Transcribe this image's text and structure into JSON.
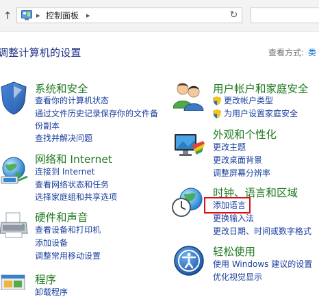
{
  "address_bar": {
    "up_arrow": "↑",
    "breadcrumb_sep": "▸",
    "breadcrumb": "控制面板",
    "dropdown": "▾",
    "refresh": "↻"
  },
  "header": {
    "title": "调整计算机的设置",
    "view_by_label": "查看方式:",
    "view_by_value": "类"
  },
  "categories": {
    "system": {
      "title": "系统和安全",
      "links": [
        "查看你的计算机状态",
        "通过文件历史记录保存你的文件备",
        "份副本",
        "查找并解决问题"
      ]
    },
    "network": {
      "title": "网络和 Internet",
      "links": [
        "连接到 Internet",
        "查看网络状态和任务",
        "选择家庭组和共享选项"
      ]
    },
    "hardware": {
      "title": "硬件和声音",
      "links": [
        "查看设备和打印机",
        "添加设备",
        "调整常用移动设置"
      ]
    },
    "programs": {
      "title": "程序",
      "links": [
        "卸载程序"
      ]
    },
    "accounts": {
      "title": "用户帐户和家庭安全",
      "links": [
        "更改帐户类型",
        "为用户设置家庭安全"
      ]
    },
    "appearance": {
      "title": "外观和个性化",
      "links": [
        "更改主题",
        "更改桌面背景",
        "调整屏幕分辨率"
      ]
    },
    "clock": {
      "title": "时钟、语言和区域",
      "links": [
        "添加语言",
        "更换输入法",
        "更改日期、时间或数字格式"
      ]
    },
    "ease": {
      "title": "轻松使用",
      "links": [
        "使用 Windows 建议的设置",
        "优化视觉显示"
      ]
    }
  },
  "colors": {
    "category_title": "#1e7a1e",
    "link": "#1a3f9e",
    "page_title": "#1e3287",
    "highlight": "#d8101a"
  },
  "icons": {
    "system": "shield-icon",
    "network": "globe-network-icon",
    "hardware": "printer-icon",
    "programs": "programs-icon",
    "accounts": "users-icon",
    "appearance": "monitor-palette-icon",
    "clock": "clock-globe-icon",
    "ease": "ease-of-access-icon"
  }
}
